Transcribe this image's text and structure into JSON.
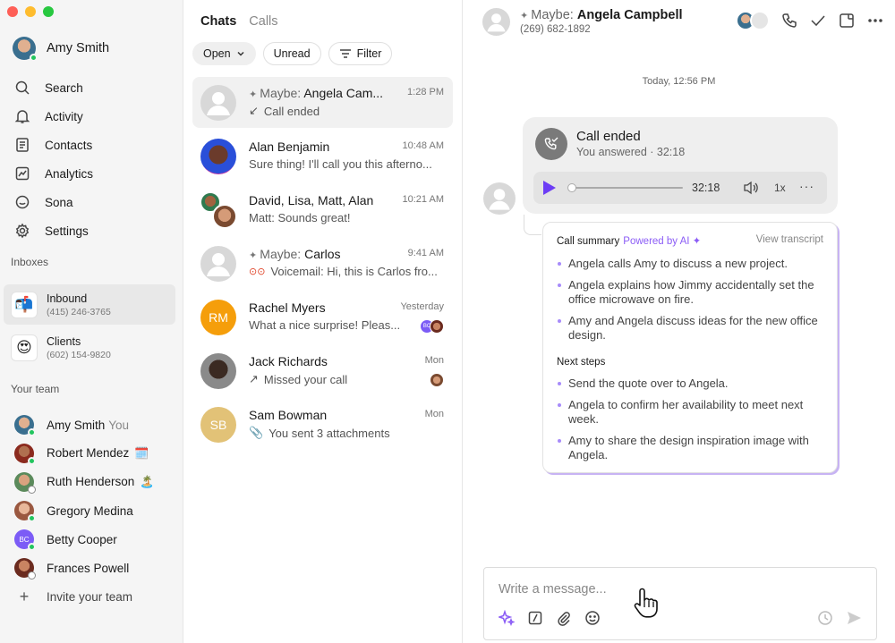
{
  "user": {
    "name": "Amy Smith"
  },
  "nav": [
    {
      "label": "Search",
      "icon": "search-icon"
    },
    {
      "label": "Activity",
      "icon": "bell-icon"
    },
    {
      "label": "Contacts",
      "icon": "contacts-icon"
    },
    {
      "label": "Analytics",
      "icon": "analytics-icon"
    },
    {
      "label": "Sona",
      "icon": "sona-icon"
    },
    {
      "label": "Settings",
      "icon": "gear-icon"
    }
  ],
  "inboxes_label": "Inboxes",
  "inboxes": [
    {
      "title": "Inbound",
      "phone": "(415) 246-3765",
      "icon": "📬"
    },
    {
      "title": "Clients",
      "phone": "(602) 154-9820",
      "icon": "😍"
    }
  ],
  "team_label": "Your team",
  "team": [
    {
      "name": "Amy Smith",
      "suffix": "You",
      "emoji": ""
    },
    {
      "name": "Robert Mendez",
      "suffix": "",
      "emoji": "🗓️"
    },
    {
      "name": "Ruth Henderson",
      "suffix": "",
      "emoji": "🏝️"
    },
    {
      "name": "Gregory Medina",
      "suffix": "",
      "emoji": ""
    },
    {
      "name": "Betty Cooper",
      "suffix": "",
      "emoji": ""
    },
    {
      "name": "Frances Powell",
      "suffix": "",
      "emoji": ""
    }
  ],
  "invite_label": "Invite your team",
  "list": {
    "tabs": [
      "Chats",
      "Calls"
    ],
    "filters": [
      "Open",
      "Unread",
      "Filter"
    ],
    "conversations": [
      {
        "prefix": "Maybe:",
        "name": "Angela Cam...",
        "time": "1:28 PM",
        "preview": "Call ended",
        "initials": ""
      },
      {
        "prefix": "",
        "name": "Alan Benjamin",
        "time": "10:48 AM",
        "preview": "Sure thing! I'll call you this afterno...",
        "initials": ""
      },
      {
        "prefix": "",
        "name": "David, Lisa, Matt, Alan",
        "time": "10:21 AM",
        "preview": "Matt: Sounds great!",
        "initials": ""
      },
      {
        "prefix": "Maybe:",
        "name": "Carlos",
        "time": "9:41 AM",
        "preview": "Voicemail: Hi, this is Carlos fro...",
        "initials": ""
      },
      {
        "prefix": "",
        "name": "Rachel Myers",
        "time": "Yesterday",
        "preview": "What a nice surprise! Pleas...",
        "initials": "RM"
      },
      {
        "prefix": "",
        "name": "Jack Richards",
        "time": "Mon",
        "preview": "Missed your call",
        "initials": ""
      },
      {
        "prefix": "",
        "name": "Sam Bowman",
        "time": "Mon",
        "preview": "You sent 3 attachments",
        "initials": "SB"
      }
    ]
  },
  "chat": {
    "prefix": "Maybe:",
    "name": "Angela Campbell",
    "phone": "(269) 682-1892",
    "day": "Today, 12:56 PM",
    "call_title": "Call ended",
    "call_status": "You answered · 32:18",
    "duration": "32:18",
    "speed": "1x",
    "summary_label": "Call summary",
    "powered": "Powered by AI",
    "view_transcript": "View transcript",
    "summary": [
      "Angela calls Amy to discuss a new project.",
      "Angela explains how Jimmy accidentally set the office microwave on fire.",
      "Amy and Angela discuss ideas for the new office design."
    ],
    "next_label": "Next steps",
    "next_steps": [
      "Send the quote over to Angela.",
      "Angela to confirm her availability to meet next week.",
      "Amy to share the design inspiration image with Angela."
    ],
    "composer_placeholder": "Write a message..."
  },
  "colors": {
    "accent": "#6d3df5",
    "ai": "#8b5cf6",
    "online": "#22c55e",
    "rm": "#f59e0b",
    "sb": "#e2c277"
  }
}
